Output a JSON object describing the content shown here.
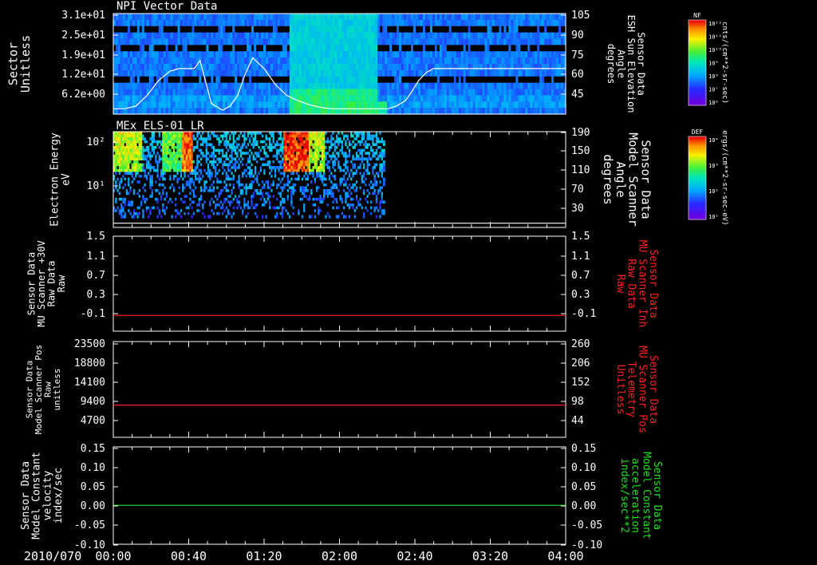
{
  "date_label": "2010/070",
  "time_ticks": [
    "00:00",
    "00:40",
    "01:20",
    "02:00",
    "02:40",
    "03:20",
    "04:00"
  ],
  "colors": {
    "white": "#ffffff",
    "red": "#ff2020",
    "green": "#20e020"
  },
  "chart_data": [
    {
      "type": "heatmap",
      "title": "NPI Vector Data",
      "ylabel_left": [
        "Sector",
        "Unitless"
      ],
      "yticks_left": [
        "3.1e+01",
        "2.5e+01",
        "1.9e+01",
        "1.2e+01",
        "6.2e+00"
      ],
      "ylabel_right": [
        "Sensor Data",
        "ESH Sun Elevation",
        "Angle",
        "degrees"
      ],
      "yticks_right": [
        "105",
        "90",
        "75",
        "60",
        "45"
      ],
      "ylim_right": [
        30,
        105
      ],
      "colorbar": {
        "label": "NF",
        "units": "cnts/(cm**2-sr-sec)",
        "ticks": [
          "10¹²",
          "10¹¹",
          "10¹⁰",
          "10⁹",
          "10⁸",
          "10⁷",
          "10⁶"
        ]
      },
      "overlay_line": {
        "name": "ESH Sun Elevation Angle",
        "x_minutes": [
          0,
          6,
          12,
          18,
          24,
          30,
          35,
          38,
          43,
          46,
          52,
          58,
          62,
          66,
          70,
          74,
          80,
          86,
          92,
          98,
          104,
          110,
          116,
          122,
          128,
          134,
          140,
          146,
          150,
          155,
          158,
          162,
          166,
          170,
          174,
          178,
          182,
          186,
          200,
          210,
          220,
          230,
          240
        ],
        "y_degrees": [
          34,
          34,
          36,
          44,
          55,
          62,
          64,
          64,
          64,
          70,
          38,
          33,
          36,
          44,
          60,
          72,
          64,
          52,
          44,
          40,
          37,
          35,
          34,
          34,
          34,
          34,
          34,
          34,
          36,
          40,
          46,
          55,
          61,
          64,
          64,
          64,
          64,
          64,
          64,
          64,
          64,
          64,
          64
        ]
      }
    },
    {
      "type": "heatmap",
      "title": "MEx ELS-01 LR",
      "ylabel_left": [
        "Electron Energy",
        "eV"
      ],
      "yticks_left": [
        "10²",
        "10¹"
      ],
      "ylabel_right": [
        "Sensor Data",
        "Model Scanner",
        "Angle",
        "degrees"
      ],
      "yticks_right": [
        "190",
        "150",
        "110",
        "70",
        "30"
      ],
      "ylim_right": [
        10,
        190
      ],
      "colorbar": {
        "label": "DEF",
        "units": "ergs/(cm**2-sr-sec-eV)",
        "ticks": [
          "10⁴",
          "10³",
          "10²",
          "10¹"
        ]
      },
      "overlay_line": {
        "name": "Model Scanner Angle",
        "x_minutes": [
          0,
          240
        ],
        "y_degrees": [
          18,
          18
        ]
      }
    },
    {
      "type": "line",
      "ylabel_left": [
        "Sensor Data",
        "MU Scanner +30V",
        "Raw Data",
        "Raw"
      ],
      "yticks_left": [
        "1.5",
        "1.1",
        "0.7",
        "0.3",
        "-0.1"
      ],
      "ylim_left": [
        -0.3,
        1.5
      ],
      "ylabel_right": [
        "Sensor Data",
        "MU Scanner Inh",
        "Raw Data",
        "Raw"
      ],
      "yticks_right": [
        "1.5",
        "1.1",
        "0.7",
        "0.3",
        "-0.1"
      ],
      "series": [
        {
          "x_minutes": [
            0,
            240
          ],
          "values": [
            0,
            0
          ],
          "color": "#ff2020"
        }
      ]
    },
    {
      "type": "line",
      "ylabel_left": [
        "Sensor Data",
        "Model Scanner Pos",
        "Raw",
        "unitless"
      ],
      "yticks_left": [
        "23500",
        "18800",
        "14100",
        "9400",
        "4700"
      ],
      "ylim_left": [
        0,
        23500
      ],
      "ylabel_right": [
        "Sensor Data",
        "MU Scanner Pos",
        "Telemetry",
        "Unitless"
      ],
      "yticks_right": [
        "260",
        "206",
        "152",
        "98",
        "44"
      ],
      "series": [
        {
          "x_minutes": [
            0,
            240
          ],
          "values": [
            7900,
            7900
          ],
          "color": "#ff2020"
        }
      ]
    },
    {
      "type": "line",
      "ylabel_left": [
        "Sensor Data",
        "Model Constant",
        "velocity",
        "index/sec"
      ],
      "yticks_left": [
        "0.15",
        "0.10",
        "0.05",
        "0.00",
        "-0.05",
        "-0.10"
      ],
      "ylim_left": [
        -0.1,
        0.15
      ],
      "ylabel_right": [
        "Sensor Data",
        "Model Constant",
        "acceleration",
        "index/sec**2"
      ],
      "yticks_right": [
        "0.15",
        "0.10",
        "0.05",
        "0.00",
        "-0.05",
        "-0.10"
      ],
      "series": [
        {
          "x_minutes": [
            0,
            240
          ],
          "values": [
            0,
            0
          ],
          "color": "#20e020"
        }
      ]
    }
  ]
}
